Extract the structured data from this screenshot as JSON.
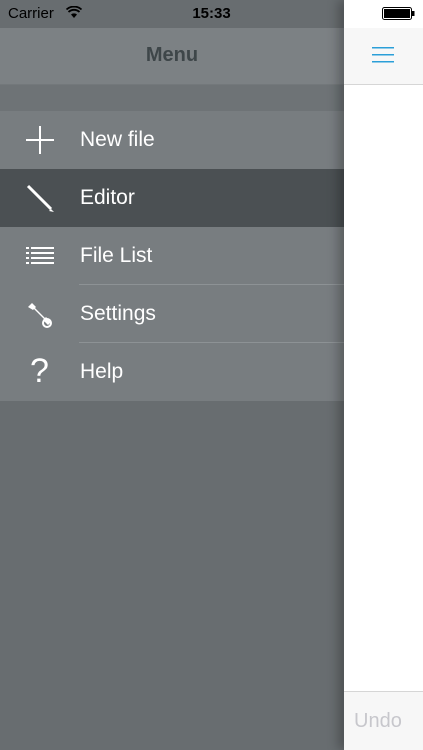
{
  "status_bar": {
    "carrier": "Carrier",
    "time": "15:33"
  },
  "menu": {
    "title": "Menu",
    "items": [
      {
        "label": "New file",
        "icon": "plus-icon",
        "selected": false
      },
      {
        "label": "Editor",
        "icon": "pencil-icon",
        "selected": true
      },
      {
        "label": "File List",
        "icon": "list-icon",
        "selected": false
      },
      {
        "label": "Settings",
        "icon": "wrench-icon",
        "selected": false
      },
      {
        "label": "Help",
        "icon": "question-icon",
        "selected": false
      }
    ]
  },
  "content": {
    "undo_label": "Undo"
  },
  "colors": {
    "accent": "#2b9fd8",
    "selected_row": "#4b5053",
    "menu_bg": "#686d70"
  }
}
